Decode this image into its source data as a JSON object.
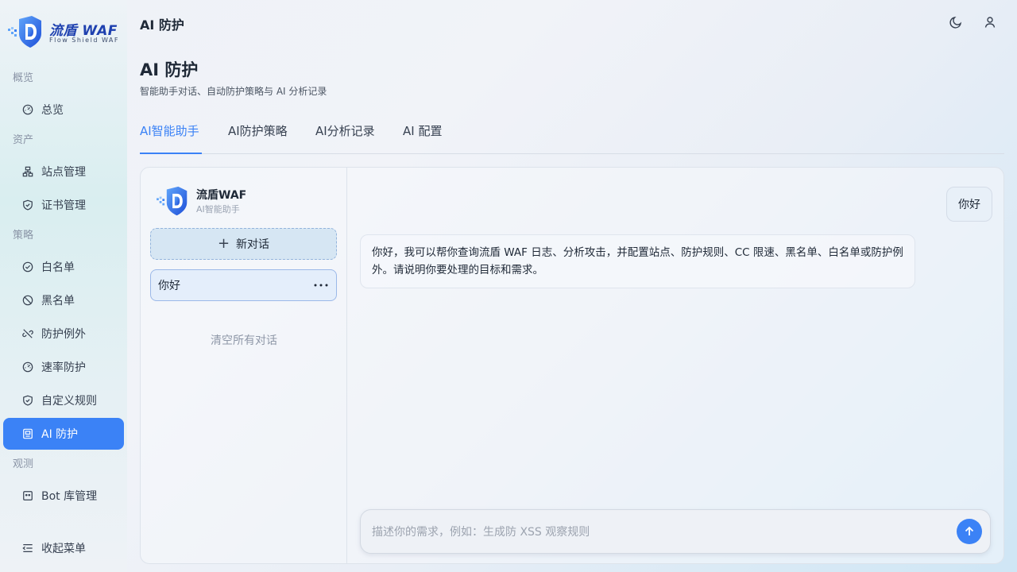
{
  "brand": {
    "name": "流盾 WAF",
    "tagline": "Flow Shield WAF"
  },
  "sidebar": {
    "sections": [
      {
        "label": "概览",
        "items": [
          {
            "label": "总览",
            "icon": "gauge-icon"
          }
        ]
      },
      {
        "label": "资产",
        "items": [
          {
            "label": "站点管理",
            "icon": "sitemap-icon"
          },
          {
            "label": "证书管理",
            "icon": "shield-check-icon"
          }
        ]
      },
      {
        "label": "策略",
        "items": [
          {
            "label": "白名单",
            "icon": "check-circle-icon"
          },
          {
            "label": "黑名单",
            "icon": "ban-icon"
          },
          {
            "label": "防护例外",
            "icon": "unlink-icon"
          },
          {
            "label": "速率防护",
            "icon": "gauge-icon"
          },
          {
            "label": "自定义规则",
            "icon": "shield-check-icon"
          },
          {
            "label": "AI 防护",
            "icon": "robot-icon",
            "active": true
          }
        ]
      },
      {
        "label": "观测",
        "items": [
          {
            "label": "Bot 库管理",
            "icon": "bot-icon"
          }
        ]
      }
    ],
    "collapse_label": "收起菜单"
  },
  "topbar": {
    "title": "AI 防护"
  },
  "page": {
    "title": "AI 防护",
    "subtitle": "智能助手对话、自动防护策略与 AI 分析记录"
  },
  "tabs": [
    {
      "label": "AI智能助手",
      "active": true
    },
    {
      "label": "AI防护策略"
    },
    {
      "label": "AI分析记录"
    },
    {
      "label": "AI 配置"
    }
  ],
  "assistant": {
    "name": "流盾WAF",
    "role": "AI智能助手"
  },
  "conversations": {
    "new_label": "新对话",
    "items": [
      {
        "title": "你好"
      }
    ],
    "clear_all_label": "清空所有对话"
  },
  "chat": {
    "messages": [
      {
        "role": "user",
        "text": "你好"
      },
      {
        "role": "assistant",
        "text": "你好，我可以帮你查询流盾 WAF 日志、分析攻击，并配置站点、防护规则、CC 限速、黑名单、白名单或防护例外。请说明你要处理的目标和需求。"
      }
    ],
    "input_placeholder": "描述你的需求，例如：生成防 XSS 观察规则",
    "input_value": ""
  },
  "colors": {
    "accent": "#3b82f6",
    "active_nav_bg": "#3b82f6",
    "text": "#1f2937",
    "muted": "#8a94a6"
  }
}
